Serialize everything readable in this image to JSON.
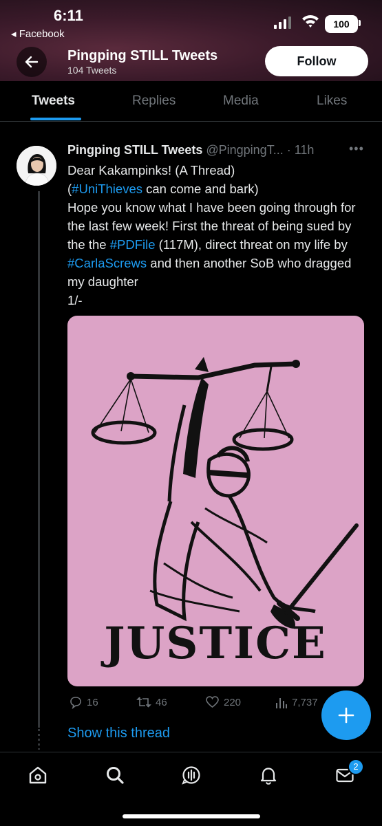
{
  "status_bar": {
    "time": "6:11",
    "back_app": "◂ Facebook",
    "battery": "100"
  },
  "header": {
    "profile_name": "Pingping STILL Tweets",
    "tweet_count": "104 Tweets",
    "follow_label": "Follow"
  },
  "tabs": [
    {
      "label": "Tweets",
      "active": true
    },
    {
      "label": "Replies",
      "active": false
    },
    {
      "label": "Media",
      "active": false
    },
    {
      "label": "Likes",
      "active": false
    }
  ],
  "tweet": {
    "author_name": "Pingping STILL Tweets",
    "handle": "@PingpingT...",
    "time": "· 11h",
    "line1": "Dear Kakampinks! (A Thread)",
    "line2_pre": "(",
    "hashtag1": "#UniThieves",
    "line2_post": " can come and bark)",
    "line3": "Hope you know what I have been going through for the last few week! First the threat of being sued by the the ",
    "hashtag2": "#PDFile",
    "line4_mid": " (117M), direct threat on my life by ",
    "hashtag3": "#CarlaScrews",
    "line5": " and then another SoB who dragged my daughter",
    "line6": "1/-",
    "image_text": "JUSTICE",
    "replies": "16",
    "retweets": "46",
    "likes": "220",
    "views": "7,737",
    "show_thread": "Show this thread"
  },
  "nav": {
    "messages_badge": "2"
  },
  "colors": {
    "accent": "#1d9bf0",
    "background": "#000000",
    "image_bg": "#dca3c6"
  }
}
